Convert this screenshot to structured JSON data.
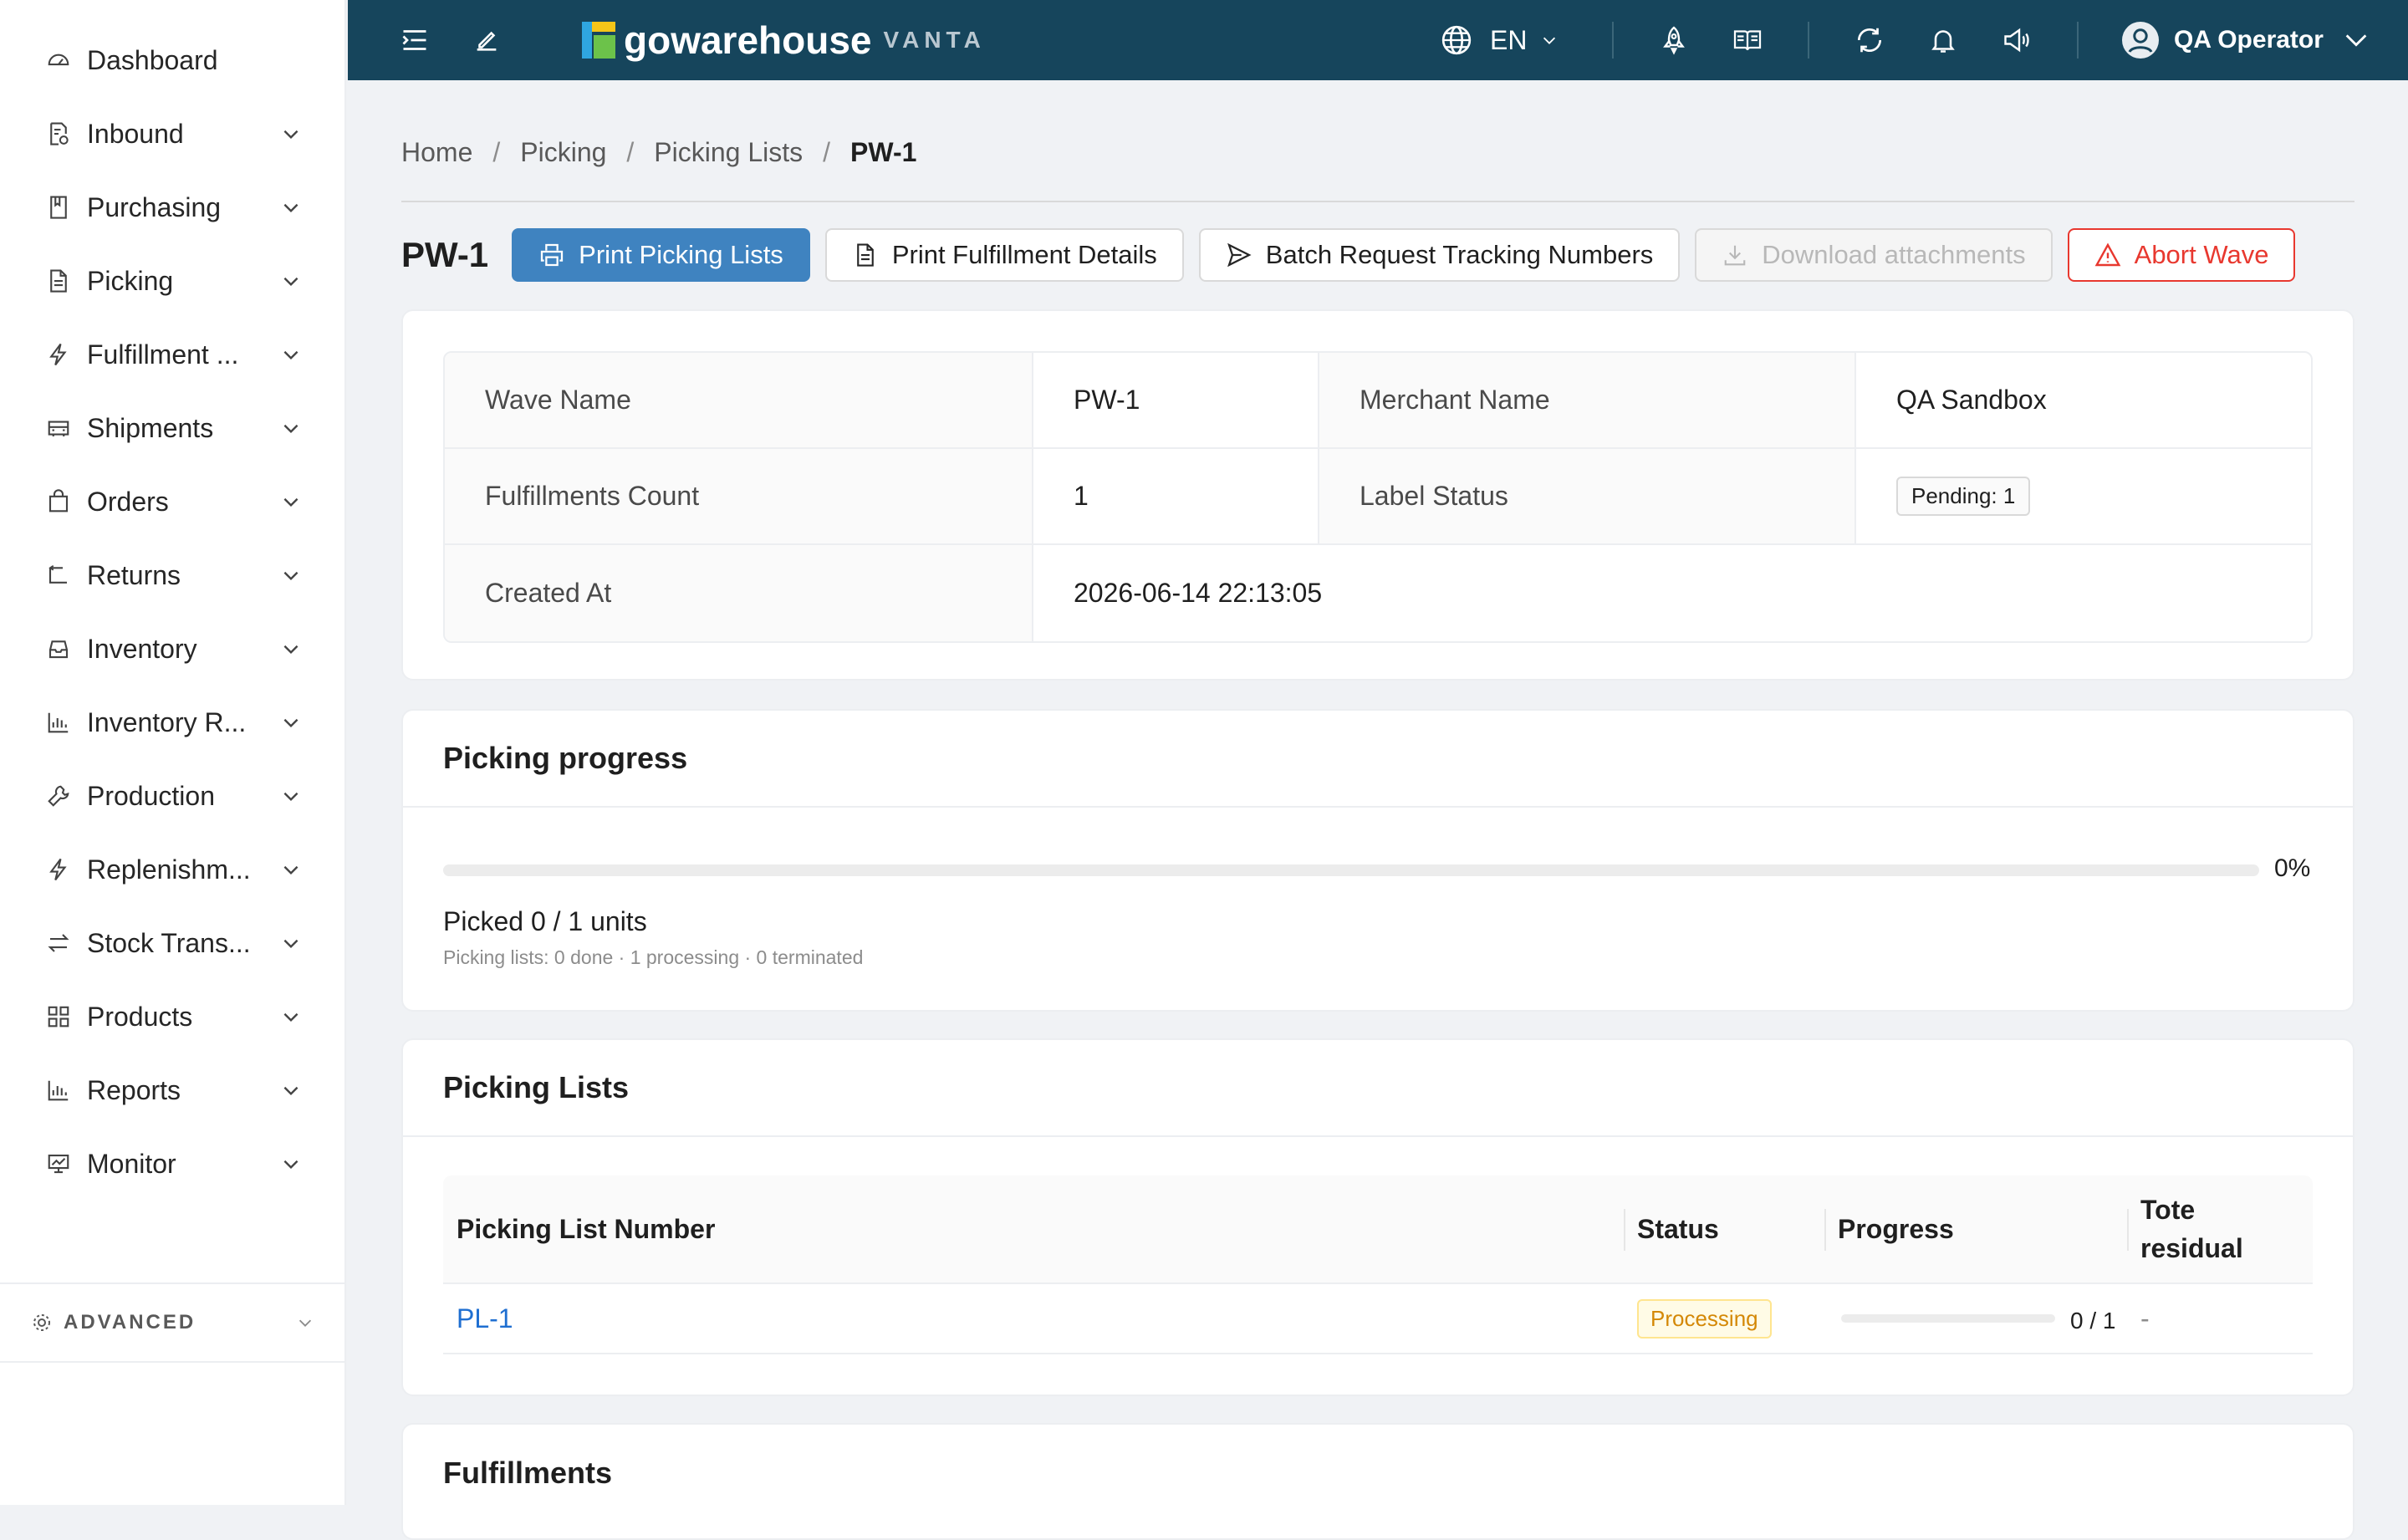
{
  "sidebar": {
    "items": [
      {
        "label": "Dashboard",
        "icon": "dashboard-icon",
        "expandable": false
      },
      {
        "label": "Inbound",
        "icon": "inbound-icon",
        "expandable": true
      },
      {
        "label": "Purchasing",
        "icon": "purchasing-icon",
        "expandable": true
      },
      {
        "label": "Picking",
        "icon": "picking-icon",
        "expandable": true
      },
      {
        "label": "Fulfillment ...",
        "icon": "lightning-icon",
        "expandable": true
      },
      {
        "label": "Shipments",
        "icon": "truck-icon",
        "expandable": true
      },
      {
        "label": "Orders",
        "icon": "shopping-bag-icon",
        "expandable": true
      },
      {
        "label": "Returns",
        "icon": "return-icon",
        "expandable": true
      },
      {
        "label": "Inventory",
        "icon": "inbox-icon",
        "expandable": true
      },
      {
        "label": "Inventory R...",
        "icon": "bar-chart-icon",
        "expandable": true
      },
      {
        "label": "Production",
        "icon": "wrench-icon",
        "expandable": true
      },
      {
        "label": "Replenishm...",
        "icon": "lightning-icon",
        "expandable": true
      },
      {
        "label": "Stock Trans...",
        "icon": "swap-icon",
        "expandable": true
      },
      {
        "label": "Products",
        "icon": "grid-icon",
        "expandable": true
      },
      {
        "label": "Reports",
        "icon": "bar-chart-icon",
        "expandable": true
      },
      {
        "label": "Monitor",
        "icon": "monitor-icon",
        "expandable": true
      }
    ],
    "advanced_label": "ADVANCED"
  },
  "header": {
    "logo_text": "gowarehouse",
    "logo_sub": "VANTA",
    "language": "EN",
    "user_name": "QA Operator",
    "background_color": "#16455c"
  },
  "breadcrumb": [
    "Home",
    "Picking",
    "Picking Lists",
    "PW-1"
  ],
  "page": {
    "title": "PW-1",
    "buttons": {
      "print_picking_lists": "Print Picking Lists",
      "print_fulfillment_details": "Print Fulfillment Details",
      "batch_request_tracking": "Batch Request Tracking Numbers",
      "download_attachments": "Download attachments",
      "abort_wave": "Abort Wave"
    }
  },
  "details": {
    "wave_name_label": "Wave Name",
    "wave_name": "PW-1",
    "merchant_name_label": "Merchant Name",
    "merchant_name": "QA Sandbox",
    "fulfillments_count_label": "Fulfillments Count",
    "fulfillments_count": "1",
    "label_status_label": "Label Status",
    "label_status": "Pending: 1",
    "created_at_label": "Created At",
    "created_at": "2026-06-14 22:13:05"
  },
  "picking_progress": {
    "title": "Picking progress",
    "percent_text": "0%",
    "percent": 0,
    "summary": "Picked 0 / 1 units",
    "detail": "Picking lists: 0 done · 1 processing · 0 terminated"
  },
  "picking_lists": {
    "title": "Picking Lists",
    "columns": [
      "Picking List Number",
      "Status",
      "Progress",
      "Tote residual"
    ],
    "rows": [
      {
        "number": "PL-1",
        "status": "Processing",
        "progress_text": "0 / 1",
        "progress": 0,
        "tote_residual": "-"
      }
    ]
  },
  "fulfillments": {
    "title": "Fulfillments"
  }
}
